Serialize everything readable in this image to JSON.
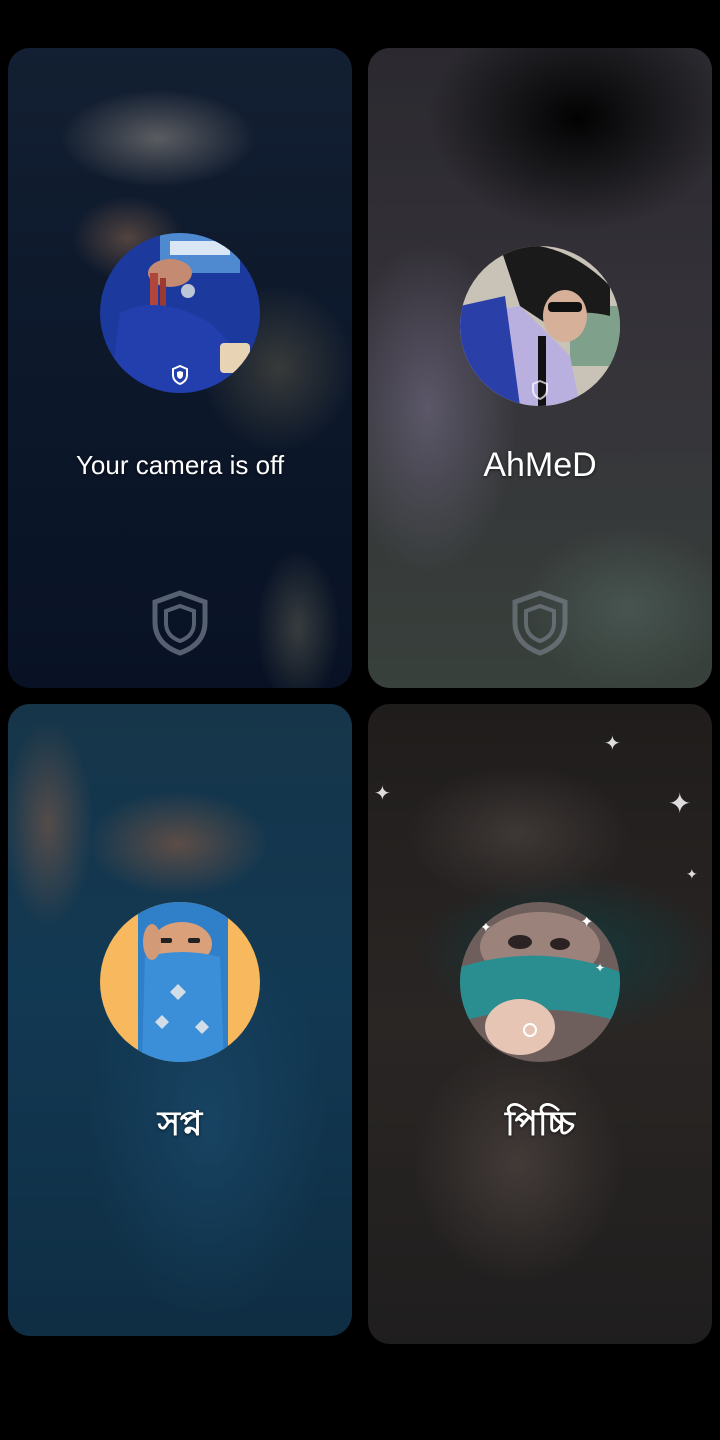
{
  "participants": [
    {
      "name": "Your camera is off",
      "avatar_icon": "avatar-photo-icon",
      "badge_icon": "shield-icon",
      "watermark_icon": "shield-icon"
    },
    {
      "name": "AhMeD",
      "avatar_icon": "avatar-photo-icon",
      "badge_icon": "shield-icon",
      "watermark_icon": "shield-icon"
    },
    {
      "name": "সপ্ন",
      "avatar_icon": "avatar-photo-icon"
    },
    {
      "name": "পিচ্চি",
      "avatar_icon": "avatar-photo-icon"
    }
  ],
  "colors": {
    "background": "#000000",
    "label": "#ffffff",
    "avatar3_bg": "#f7b85e",
    "avatar1_bg": "#1c3a9e",
    "avatar4_bg": "#2a8d90"
  }
}
